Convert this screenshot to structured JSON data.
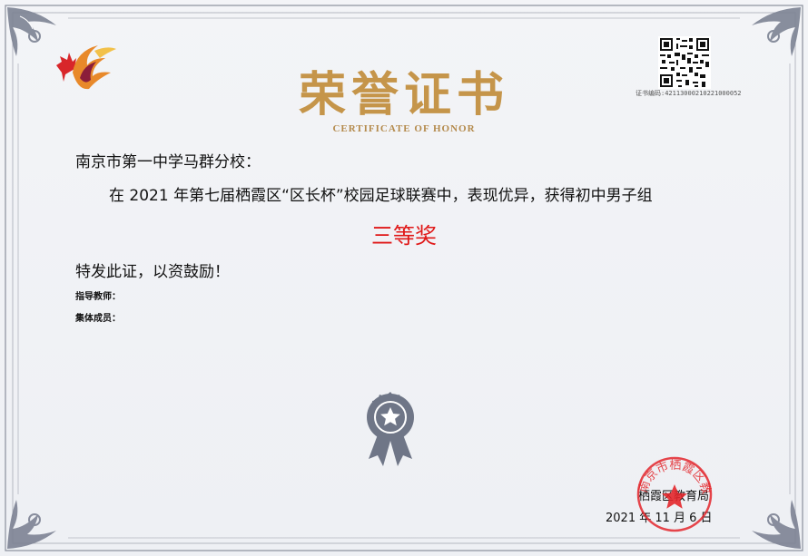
{
  "certificate": {
    "title": "荣誉证书",
    "subtitle": "CERTIFICATE OF HONOR",
    "cert_number": "证书编码:42113000210221000052",
    "recipient": "南京市第一中学马群分校：",
    "body": "在 2021 年第七届栖霞区“区长杯”校园足球联赛中，表现优异，获得初中男子组",
    "award": "三等奖",
    "closing": "特发此证，以资鼓励！",
    "instructor_label": "指导教师：",
    "members_label": "集体成员：",
    "issuer": "栖霞区教育局",
    "date": "2021 年 11 月 6 日",
    "seal_text": "南京市栖霞区教育局"
  },
  "colors": {
    "title": "#c5954a",
    "award": "#e01818",
    "seal": "#e3262b",
    "frame": "#8a8f9c",
    "medal": "#6f7687"
  },
  "icons": {
    "logo": "flame-leaf-logo",
    "qr": "qr-code-icon",
    "medal": "star-medal-icon",
    "seal": "official-seal-stamp"
  }
}
